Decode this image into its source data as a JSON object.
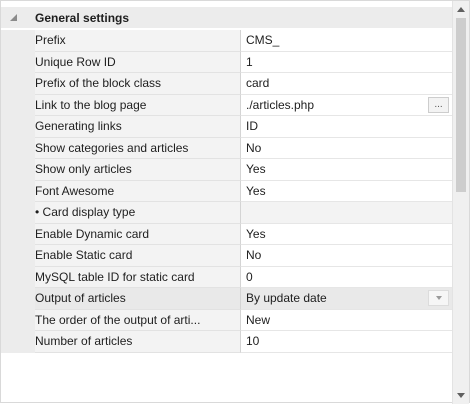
{
  "category": {
    "title": "General settings",
    "toggle_icon": "collapse-triangle-icon"
  },
  "rows": [
    {
      "name": "Prefix",
      "value": "CMS_"
    },
    {
      "name": "Unique Row ID",
      "value": "1"
    },
    {
      "name": "Prefix of the block class",
      "value": "card"
    },
    {
      "name": "Link to the blog page",
      "value": "./articles.php",
      "button": "..."
    },
    {
      "name": "Generating links",
      "value": "ID"
    },
    {
      "name": "Show categories and articles",
      "value": "No"
    },
    {
      "name": "Show only articles",
      "value": "Yes"
    },
    {
      "name": "Font Awesome",
      "value": "Yes"
    },
    {
      "name": "• Card display type",
      "value": ""
    },
    {
      "name": "Enable Dynamic card",
      "value": "Yes"
    },
    {
      "name": "Enable Static card",
      "value": "No"
    },
    {
      "name": "MySQL table ID for static card",
      "value": "0"
    },
    {
      "name": "Output of articles",
      "value": "By update date",
      "dropdown": true
    },
    {
      "name": "The order of the output of arti...",
      "value": "New"
    },
    {
      "name": "Number of articles",
      "value": "10"
    }
  ],
  "scrollbar": {
    "up_icon": "scroll-up-arrow-icon",
    "down_icon": "scroll-down-arrow-icon"
  }
}
